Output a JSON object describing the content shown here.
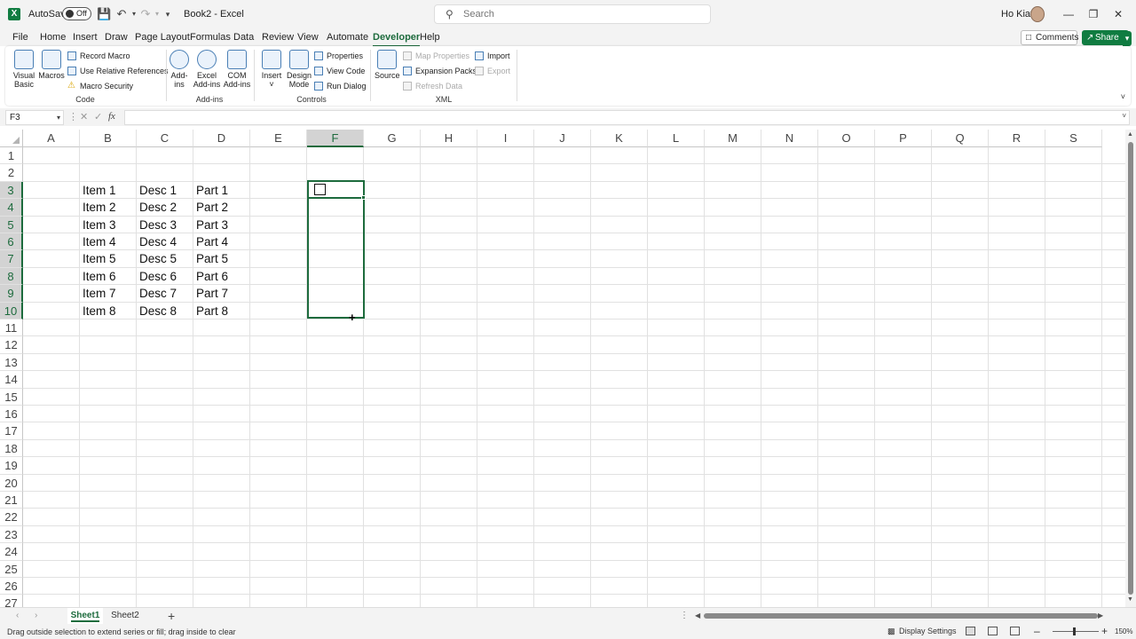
{
  "titlebar": {
    "autosave_label": "AutoSave",
    "autosave_state": "Off",
    "document_title": "Book2  -  Excel",
    "search_placeholder": "Search",
    "user_name": "Ho Kiat"
  },
  "menu": {
    "tabs": [
      "File",
      "Home",
      "Insert",
      "Draw",
      "Page Layout",
      "Formulas",
      "Data",
      "Review",
      "View",
      "Automate",
      "Developer",
      "Help"
    ],
    "active_tab": "Developer",
    "comments_label": "Comments",
    "share_label": "Share"
  },
  "ribbon": {
    "code": {
      "group_label": "Code",
      "visual_basic": [
        "Visual",
        "Basic"
      ],
      "macros": "Macros",
      "record_macro": "Record Macro",
      "use_relative_references": "Use Relative References",
      "macro_security": "Macro Security"
    },
    "addins": {
      "group_label": "Add-ins",
      "addins": [
        "Add-",
        "ins"
      ],
      "excel_addins": [
        "Excel",
        "Add-ins"
      ],
      "com_addins": [
        "COM",
        "Add-ins"
      ]
    },
    "controls": {
      "group_label": "Controls",
      "insert": "Insert",
      "design_mode": [
        "Design",
        "Mode"
      ],
      "properties": "Properties",
      "view_code": "View Code",
      "run_dialog": "Run Dialog"
    },
    "xml": {
      "group_label": "XML",
      "source": "Source",
      "map_properties": "Map Properties",
      "expansion_packs": "Expansion Packs",
      "refresh_data": "Refresh Data",
      "import": "Import",
      "export": "Export"
    }
  },
  "formula_bar": {
    "name_box": "F3",
    "fx_label": "fx",
    "formula": ""
  },
  "grid": {
    "columns": [
      "A",
      "B",
      "C",
      "D",
      "E",
      "F",
      "G",
      "H",
      "I",
      "J",
      "K",
      "L",
      "M",
      "N",
      "O",
      "P",
      "Q",
      "R",
      "S"
    ],
    "rows": [
      "1",
      "2",
      "3",
      "4",
      "5",
      "6",
      "7",
      "8",
      "9",
      "10",
      "11",
      "12",
      "13",
      "14",
      "15",
      "16",
      "17",
      "18",
      "19",
      "20",
      "21",
      "22",
      "23",
      "24",
      "25",
      "26",
      "27"
    ],
    "selected_column": "F",
    "selected_rows": [
      "3",
      "4",
      "5",
      "6",
      "7",
      "8",
      "9",
      "10"
    ],
    "data": [
      {
        "b": "Item 1",
        "c": "Desc 1",
        "d": "Part 1"
      },
      {
        "b": "Item 2",
        "c": "Desc 2",
        "d": "Part 2"
      },
      {
        "b": "Item 3",
        "c": "Desc 3",
        "d": "Part 3"
      },
      {
        "b": "Item 4",
        "c": "Desc 4",
        "d": "Part 4"
      },
      {
        "b": "Item 5",
        "c": "Desc 5",
        "d": "Part 5"
      },
      {
        "b": "Item 6",
        "c": "Desc 6",
        "d": "Part 6"
      },
      {
        "b": "Item 7",
        "c": "Desc 7",
        "d": "Part 7"
      },
      {
        "b": "Item 8",
        "c": "Desc 8",
        "d": "Part 8"
      }
    ]
  },
  "sheets": {
    "tabs": [
      "Sheet1",
      "Sheet2"
    ],
    "active": "Sheet1"
  },
  "statusbar": {
    "message": "Drag outside selection to extend series or fill; drag inside to clear",
    "display_settings": "Display Settings",
    "zoom": "150%"
  },
  "colors": {
    "excel_green": "#107c41",
    "selection_green": "#1d6b3d"
  }
}
